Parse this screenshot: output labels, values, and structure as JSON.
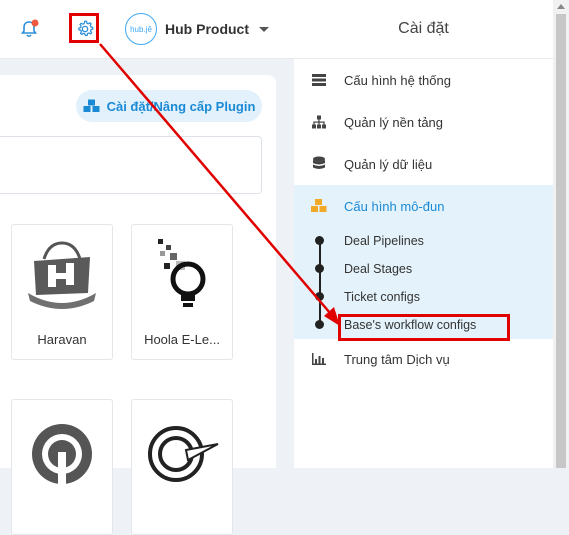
{
  "header": {
    "workspace_logo_text": "hub.jê",
    "workspace_name": "Hub Product",
    "panel_title": "Cài đặt"
  },
  "main": {
    "plugin_button_label": "Cài đặt/Nâng cấp Plugin",
    "plugins": [
      {
        "label": "Haravan"
      },
      {
        "label": "Hoola E-Le..."
      }
    ]
  },
  "settings_menu": {
    "items": [
      {
        "label": "Cấu hình hệ thống",
        "icon": "server-icon"
      },
      {
        "label": "Quản lý nền tảng",
        "icon": "sitemap-icon"
      },
      {
        "label": "Quản lý dữ liệu",
        "icon": "database-icon"
      },
      {
        "label": "Cấu hình mô-đun",
        "icon": "cubes-icon",
        "active": true
      }
    ],
    "sub_items": [
      {
        "label": "Deal Pipelines"
      },
      {
        "label": "Deal Stages"
      },
      {
        "label": "Ticket configs"
      },
      {
        "label": "Base's workflow configs"
      }
    ],
    "service_center": {
      "label": "Trung tâm Dịch vụ",
      "icon": "bar-chart-icon"
    }
  },
  "colors": {
    "accent": "#1a8ad6",
    "active_bg": "#e4f3fb",
    "highlight": "#e00000"
  }
}
